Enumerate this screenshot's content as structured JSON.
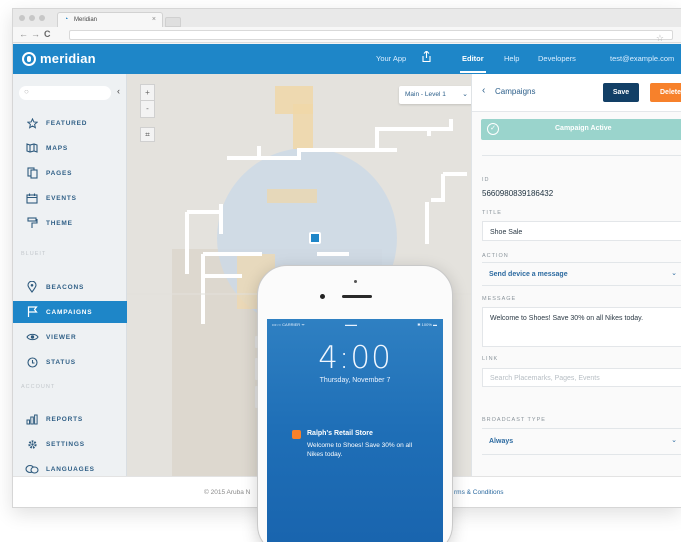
{
  "browser": {
    "tab_title": "Meridian",
    "tab_close": "×",
    "back_glyph": "←",
    "forward_glyph": "→",
    "reload_glyph": "C",
    "star_glyph": "☆"
  },
  "header": {
    "logo": "meridian",
    "nav": {
      "your_app": "Your App",
      "editor": "Editor",
      "help": "Help",
      "developers": "Developers",
      "user": "test@example.com"
    }
  },
  "sidebar": {
    "search_placeholder": "",
    "collapse_glyph": "‹",
    "items": [
      {
        "label": "FEATURED",
        "icon": "star-icon"
      },
      {
        "label": "MAPS",
        "icon": "map-icon"
      },
      {
        "label": "PAGES",
        "icon": "pages-icon"
      },
      {
        "label": "EVENTS",
        "icon": "calendar-icon"
      },
      {
        "label": "THEME",
        "icon": "paint-roller-icon"
      },
      {
        "label": "BEACONS",
        "icon": "location-pin-icon"
      },
      {
        "label": "CAMPAIGNS",
        "icon": "flag-icon"
      },
      {
        "label": "VIEWER",
        "icon": "eye-icon"
      },
      {
        "label": "STATUS",
        "icon": "clock-icon"
      },
      {
        "label": "REPORTS",
        "icon": "bar-chart-icon"
      },
      {
        "label": "SETTINGS",
        "icon": "gear-icon"
      },
      {
        "label": "LANGUAGES",
        "icon": "speech-bubbles-icon"
      }
    ],
    "active_item": "CAMPAIGNS",
    "sections": {
      "blueit": "BLUEIT",
      "account": "ACCOUNT"
    }
  },
  "map": {
    "zoom_in": "+",
    "zoom_out": "-",
    "crop_glyph": "⌗",
    "level": "Main - Level 1",
    "level_chevron": "⌄"
  },
  "panel": {
    "back_glyph": "‹",
    "title": "Campaigns",
    "save_label": "Save",
    "delete_label": "Delete",
    "active_status": "Campaign Active",
    "check_glyph": "✓",
    "id_label": "ID",
    "id_value": "5660980839186432",
    "title_label": "TITLE",
    "title_value": "Shoe Sale",
    "action_label": "ACTION",
    "action_value": "Send device a message",
    "message_label": "MESSAGE",
    "message_value": "Welcome to Shoes! Save 30% on all Nikes today.",
    "link_label": "LINK",
    "link_placeholder": "Search Placemarks, Pages, Events",
    "broadcast_label": "BROADCAST TYPE",
    "broadcast_value": "Always",
    "chevron": "⌄"
  },
  "footer": {
    "copyright": "© 2015 Aruba N",
    "terms": "rms & Conditions"
  },
  "phone": {
    "status_left": "•••○○ CARRIER ᯤ",
    "status_center": "▬▬▬",
    "status_right": "✱ 100% ▬",
    "time": "4:00",
    "date": "Thursday, November 7",
    "notification_title": "Ralph's Retail Store",
    "notification_body": "Welcome to Shoes! Save 30% on all Nikes today."
  }
}
